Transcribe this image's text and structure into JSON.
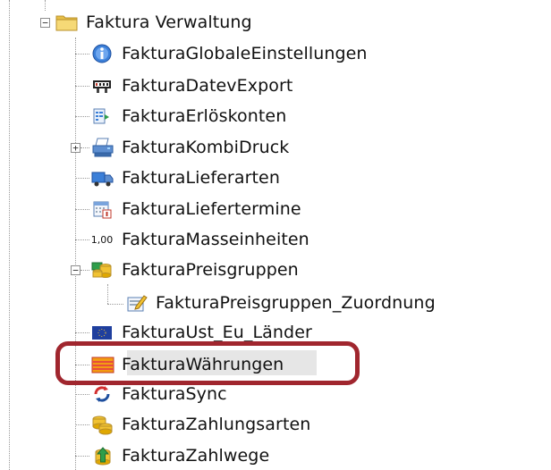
{
  "tree": {
    "root": {
      "label": "Faktura Verwaltung",
      "icon": "folder-icon",
      "expanded": true
    },
    "items": [
      {
        "label": "FakturaGlobaleEinstellungen",
        "icon": "info-icon"
      },
      {
        "label": "FakturaDatevExport",
        "icon": "datev-export-icon"
      },
      {
        "label": "FakturaErlöskonten",
        "icon": "revenue-accounts-icon"
      },
      {
        "label": "FakturaKombiDruck",
        "icon": "printer-icon",
        "expandable": true
      },
      {
        "label": "FakturaLieferarten",
        "icon": "delivery-truck-icon"
      },
      {
        "label": "FakturaLiefertermine",
        "icon": "calendar-icon"
      },
      {
        "label": "FakturaMasseinheiten",
        "icon": "units-icon",
        "icon_text": "1,00"
      },
      {
        "label": "FakturaPreisgruppen",
        "icon": "price-groups-icon",
        "expanded": true
      },
      {
        "label": "FakturaPreisgruppen_Zuordnung",
        "icon": "assignment-icon"
      },
      {
        "label": "FakturaUst_Eu_Länder",
        "icon": "eu-flag-icon"
      },
      {
        "label": "FakturaWährungen",
        "icon": "currency-icon",
        "selected": true
      },
      {
        "label": "FakturaSync",
        "icon": "sync-icon"
      },
      {
        "label": "FakturaZahlungsarten",
        "icon": "payment-methods-icon"
      },
      {
        "label": "FakturaZahlwege",
        "icon": "payment-routes-icon"
      }
    ]
  },
  "colors": {
    "highlight": "#a0262e",
    "folder": "#e8c048",
    "info": "#3b7fd8"
  }
}
